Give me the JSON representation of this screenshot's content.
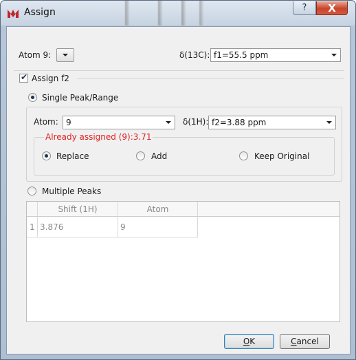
{
  "window": {
    "title": "Assign",
    "help_glyph": "?",
    "close_glyph": "X"
  },
  "top": {
    "atom_label": "Atom 9:",
    "atom_value": "",
    "delta_label": "δ(13C):",
    "delta_value": "f1=55.5 ppm"
  },
  "assign_f2": {
    "label": "Assign f2",
    "checked": true
  },
  "single": {
    "label": "Single Peak/Range",
    "selected": true,
    "atom_label": "Atom:",
    "atom_value": "9",
    "delta_label": "δ(1H):",
    "delta_value": "f2=3.88 ppm",
    "already_assigned": "Already assigned (9):3.71",
    "options": {
      "replace": "Replace",
      "add": "Add",
      "keep": "Keep Original"
    },
    "selected_option": "replace"
  },
  "multiple": {
    "label": "Multiple Peaks",
    "selected": false,
    "columns": [
      "Shift (1H)",
      "Atom"
    ],
    "rows": [
      {
        "index": "1",
        "shift": "3.876",
        "atom": "9"
      }
    ]
  },
  "buttons": {
    "ok": "OK",
    "cancel": "Cancel"
  },
  "colors": {
    "warning": "#e02020",
    "title_bar": "#c6d3e1",
    "close": "#c9442c"
  }
}
